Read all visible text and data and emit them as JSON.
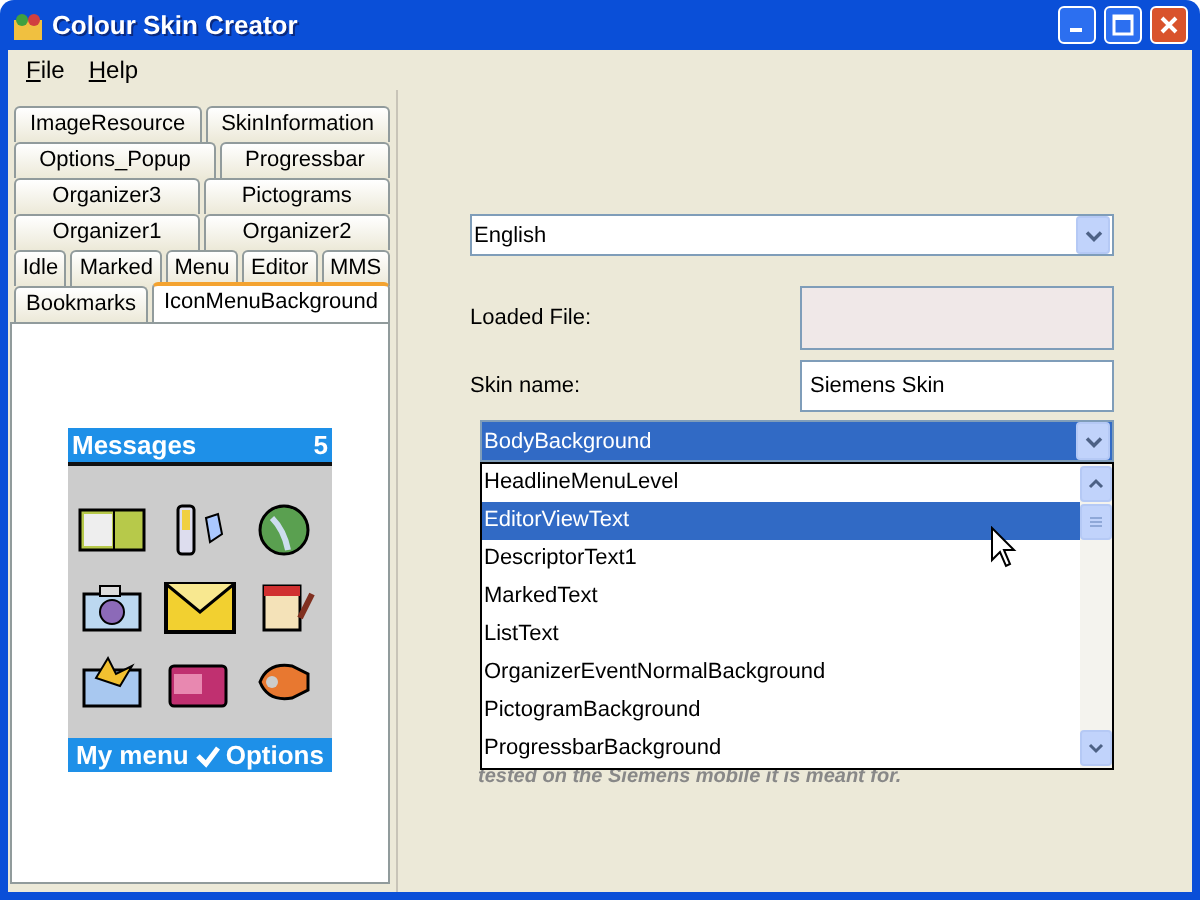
{
  "window": {
    "title": "Colour Skin Creator"
  },
  "menu": [
    {
      "label": "File"
    },
    {
      "label": "Help"
    }
  ],
  "tab_rows": [
    [
      {
        "label": "ImageResource",
        "selected": false
      },
      {
        "label": "SkinInformation",
        "selected": false
      }
    ],
    [
      {
        "label": "Options_Popup",
        "selected": false
      },
      {
        "label": "Progressbar",
        "selected": false
      }
    ],
    [
      {
        "label": "Organizer3",
        "selected": false
      },
      {
        "label": "Pictograms",
        "selected": false
      }
    ],
    [
      {
        "label": "Organizer1",
        "selected": false
      },
      {
        "label": "Organizer2",
        "selected": false
      }
    ],
    [
      {
        "label": "Idle",
        "selected": false
      },
      {
        "label": "Marked",
        "selected": false
      },
      {
        "label": "Menu",
        "selected": false
      },
      {
        "label": "Editor",
        "selected": false
      },
      {
        "label": "MMS",
        "selected": false
      }
    ],
    [
      {
        "label": "Bookmarks",
        "selected": false
      },
      {
        "label": "IconMenuBackground",
        "selected": true
      }
    ]
  ],
  "phone_preview": {
    "header": "Messages",
    "count": "5",
    "left_softkey": "My menu",
    "right_softkey": "Options"
  },
  "language": {
    "value": "English"
  },
  "loaded_file": {
    "label": "Loaded File:",
    "disabled": true
  },
  "skin_name": {
    "label": "Skin name:",
    "value": "Siemens Skin"
  },
  "element_select": {
    "value": "BodyBackground",
    "expanded": true,
    "options": [
      {
        "label": "HeadlineMenuLevel",
        "selected": false
      },
      {
        "label": "EditorViewText",
        "selected": true
      },
      {
        "label": "DescriptorText1",
        "selected": false
      },
      {
        "label": "MarkedText",
        "selected": false
      },
      {
        "label": "ListText",
        "selected": false
      },
      {
        "label": "OrganizerEventNormalBackground",
        "selected": false
      },
      {
        "label": "PictogramBackground",
        "selected": false
      },
      {
        "label": "ProgressbarBackground",
        "selected": false
      }
    ]
  },
  "note": "tested on the Siemens mobile it is meant for."
}
